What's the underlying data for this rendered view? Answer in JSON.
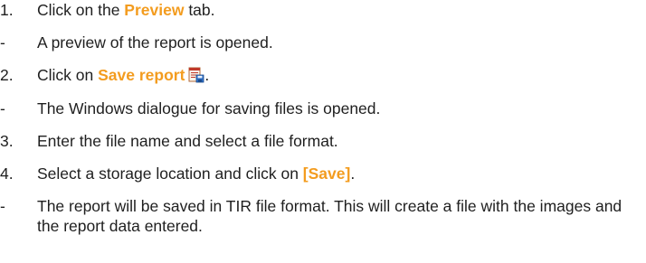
{
  "steps": {
    "s1": {
      "marker": "1.",
      "before": "Click on the ",
      "highlight": "Preview",
      "after": " tab."
    },
    "r1": {
      "marker": "-",
      "text": "A preview of the report is opened."
    },
    "s2": {
      "marker": "2.",
      "before": "Click on ",
      "highlight": "Save report",
      "after": "."
    },
    "r2": {
      "marker": "-",
      "text": "The Windows dialogue for saving files is opened."
    },
    "s3": {
      "marker": "3.",
      "text": "Enter the file name and select a file format."
    },
    "s4": {
      "marker": "4.",
      "before": "Select a storage location and click on ",
      "highlight": "[Save]",
      "after": "."
    },
    "r4": {
      "marker": "-",
      "text": "The report will be saved in TIR file format. This will create a file with the images and the report data entered."
    }
  },
  "colors": {
    "highlight": "#f39c1f",
    "text": "#1f1f1f"
  },
  "icons": {
    "save_report": "save-report-icon"
  }
}
